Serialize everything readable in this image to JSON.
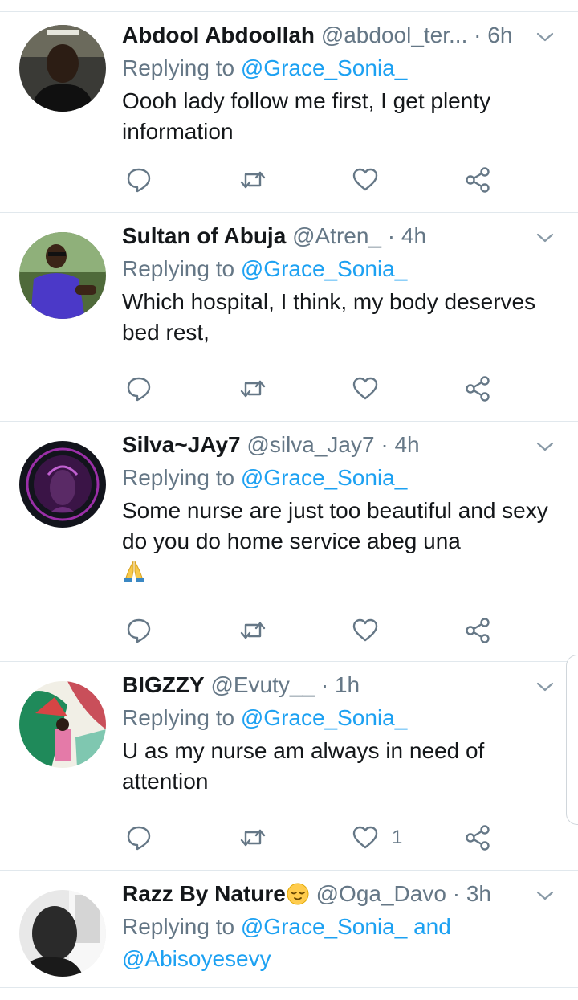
{
  "tweets": [
    {
      "name": "Abdool Abdoollah",
      "handle": "@abdool_ter...",
      "time": "6h",
      "replying_prefix": "Replying to ",
      "replying_to": "@Grace_Sonia_",
      "text": "Oooh lady follow me first, I get plenty information",
      "likes": ""
    },
    {
      "name": "Sultan of Abuja",
      "handle": "@Atren_",
      "time": "4h",
      "replying_prefix": "Replying to ",
      "replying_to": "@Grace_Sonia_",
      "text": "Which hospital, I think, my body deserves bed rest,",
      "likes": ""
    },
    {
      "name": "Silva~JAy7",
      "handle": "@silva_Jay7",
      "time": "4h",
      "replying_prefix": "Replying to ",
      "replying_to": "@Grace_Sonia_",
      "text": "Some nurse are just too beautiful and sexy  do you do home service abeg una",
      "likes": ""
    },
    {
      "name": "BIGZZY",
      "handle": "@Evuty__",
      "time": "1h",
      "replying_prefix": "Replying to ",
      "replying_to": "@Grace_Sonia_",
      "text": "U as my nurse am always in need of attention",
      "likes": "1"
    },
    {
      "name": "Razz By Nature",
      "handle": "@Oga_Davo",
      "time": "3h",
      "replying_prefix": "Replying to ",
      "replying_to": "@Grace_Sonia_",
      "replying_and": " and",
      "replying_to_2": "@Abisoyesevy",
      "text": "",
      "likes": ""
    }
  ],
  "sep": "·",
  "icons": {
    "reply": "reply-icon",
    "retweet": "retweet-icon",
    "like": "heart-icon",
    "share": "share-icon",
    "caret": "chevron-down-icon",
    "pray": "folded-hands-emoji",
    "pensive": "relieved-face-emoji"
  },
  "colors": {
    "link": "#1da1f2",
    "muted": "#657786",
    "text": "#14171a",
    "divider": "#e1e8ed"
  }
}
